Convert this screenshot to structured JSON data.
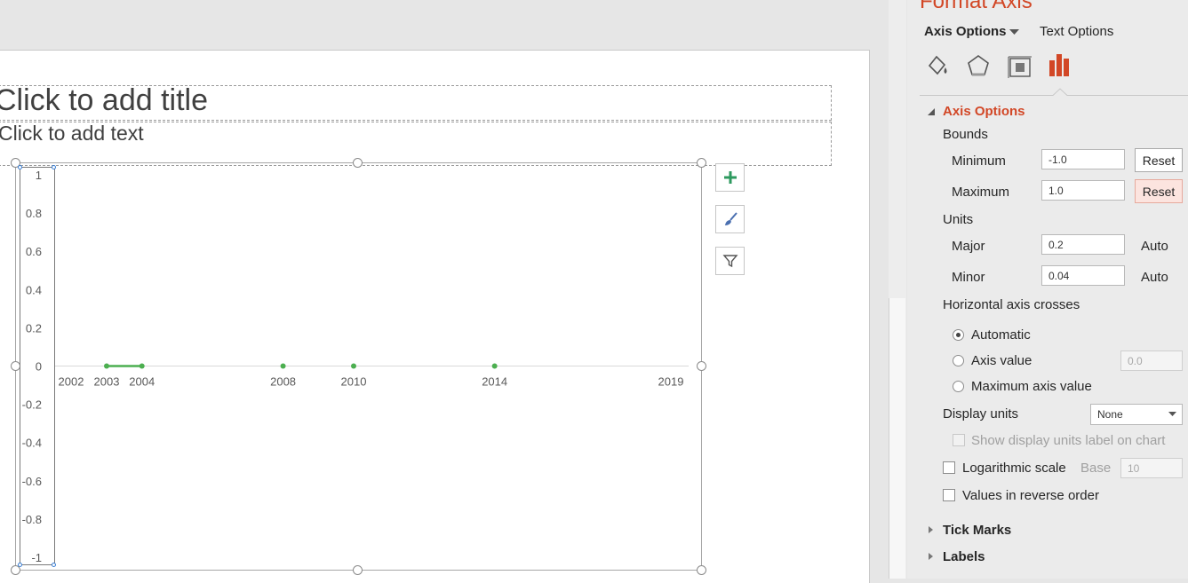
{
  "slide": {
    "title_placeholder": "Click to add title",
    "text_placeholder": "Click to add text"
  },
  "chart_data": {
    "type": "line",
    "title": "",
    "xlabel": "",
    "ylabel": "",
    "ylim": [
      -1,
      1
    ],
    "y_ticks": [
      "1",
      "0.8",
      "0.6",
      "0.4",
      "0.2",
      "0",
      "-0.2",
      "-0.4",
      "-0.6",
      "-0.8",
      "-1"
    ],
    "x_ticks": [
      "2002",
      "2003",
      "2004",
      "2008",
      "2010",
      "2014",
      "2019"
    ],
    "series": [
      {
        "x": [
          2003,
          2004,
          2008,
          2010,
          2014
        ],
        "y": [
          0,
          0,
          0,
          0,
          0
        ],
        "color": "#4caf50"
      }
    ],
    "grid": false,
    "axis_line_color": "#d9d9d9"
  },
  "chart_buttons": {
    "elements": "plus-icon",
    "styles": "paintbrush-icon",
    "filters": "funnel-icon"
  },
  "pane": {
    "title": "Format Axis",
    "tab_axis_options": "Axis Options",
    "tab_text_options": "Text Options",
    "icons": [
      "fill-line-icon",
      "effects-icon",
      "size-properties-icon",
      "axis-options-icon"
    ],
    "accent": "#d24726",
    "section_axis_options": "Axis Options",
    "bounds_label": "Bounds",
    "minimum_label": "Minimum",
    "minimum_value": "-1.0",
    "maximum_label": "Maximum",
    "maximum_value": "1.0",
    "reset_label": "Reset",
    "units_label": "Units",
    "major_label": "Major",
    "major_value": "0.2",
    "minor_label": "Minor",
    "minor_value": "0.04",
    "auto_label": "Auto",
    "crosses_label": "Horizontal axis crosses",
    "automatic_label": "Automatic",
    "axis_value_label": "Axis value",
    "axis_value_value": "0.0",
    "max_axis_value_label": "Maximum axis value",
    "display_units_label": "Display units",
    "display_units_value": "None",
    "show_units_label": "Show display units label on chart",
    "log_scale_label": "Logarithmic scale",
    "base_label": "Base",
    "base_value": "10",
    "reverse_label": "Values in reverse order",
    "tick_marks_label": "Tick Marks",
    "labels_label": "Labels"
  }
}
